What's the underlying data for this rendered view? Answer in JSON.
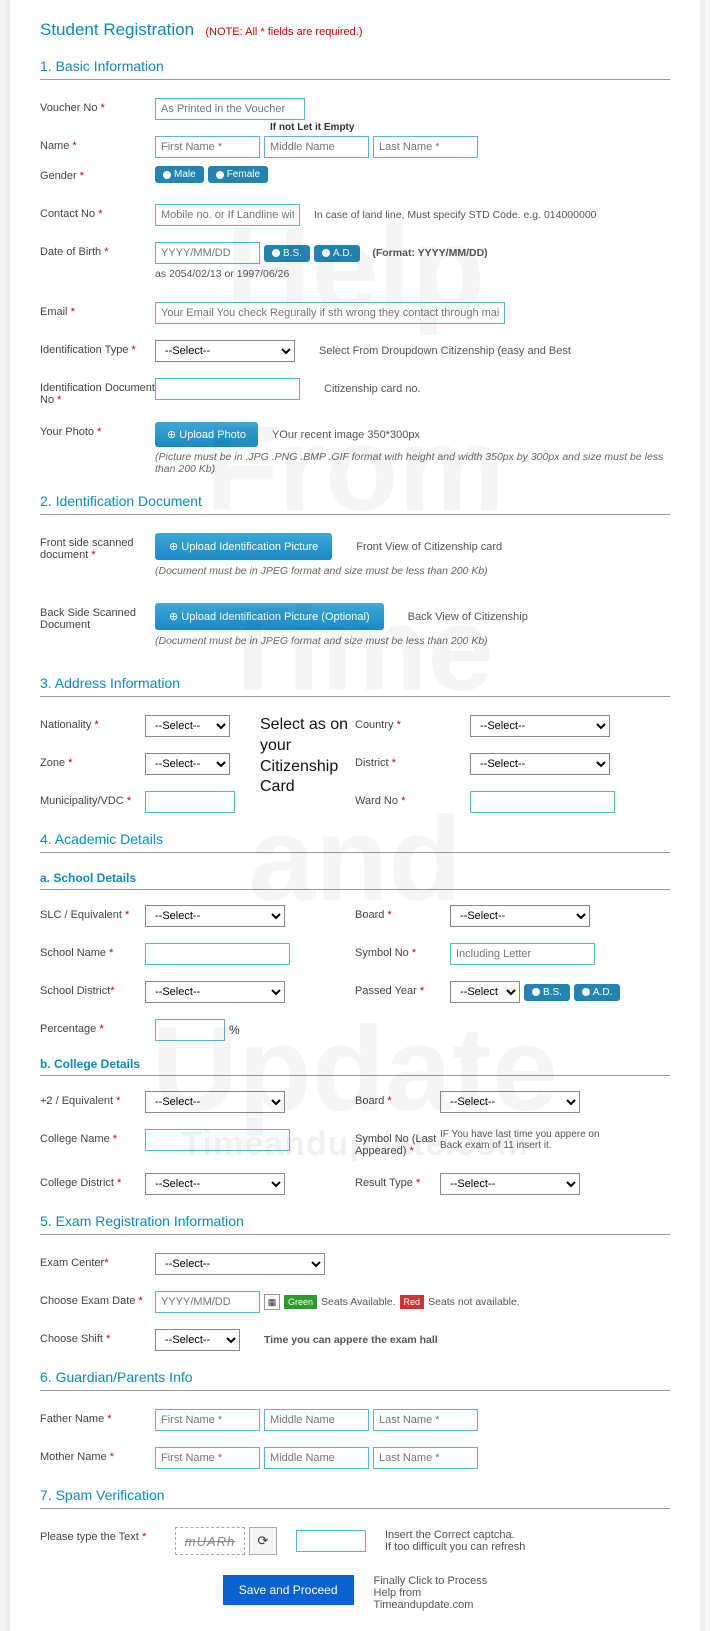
{
  "title": "Student Registration",
  "title_note": "(NOTE: All * fields are required.)",
  "sections": {
    "basic": "1. Basic Information",
    "iddoc": "2. Identification Document",
    "address": "3. Address Information",
    "academic": "4. Academic Details",
    "school_sub": "a. School Details",
    "college_sub": "b. College Details",
    "exam": "5. Exam Registration Information",
    "guardian": "6. Guardian/Parents Info",
    "spam": "7. Spam Verification"
  },
  "labels": {
    "voucher": "Voucher No",
    "name": "Name",
    "gender": "Gender",
    "contact": "Contact No",
    "dob": "Date of Birth",
    "email": "Email",
    "idtype": "Identification Type",
    "iddoc": "Identification Document No",
    "photo": "Your Photo",
    "frontscan": "Front side scanned document",
    "backscan": "Back Side Scanned Document",
    "nationality": "Nationality",
    "country": "Country",
    "zone": "Zone",
    "district": "District",
    "muni": "Municipality/VDC",
    "ward": "Ward No",
    "slc": "SLC / Equivalent",
    "board": "Board",
    "schoolname": "School Name",
    "symbol": "Symbol No",
    "schooldist": "School District",
    "passedyr": "Passed Year",
    "pct": "Percentage",
    "plus2": "+2 / Equivalent",
    "collname": "College Name",
    "symbol_last": "Symbol No (Last Appeared)",
    "colldist": "College District",
    "restype": "Result Type",
    "examcenter": "Exam Center",
    "examdate": "Choose Exam Date",
    "shift": "Choose Shift",
    "father": "Father Name",
    "mother": "Mother Name",
    "captcha": "Please type the Text"
  },
  "placeholders": {
    "voucher": "As Printed in the Voucher",
    "fname": "First Name *",
    "mname": "Middle Name",
    "lname": "Last Name *",
    "contact": "Mobile no. or If Landline with Area code",
    "dob": "YYYY/MM/DD",
    "email": "Your Email You check Regurally if sth wrong they contact through mail",
    "symbol_inc": "Including Letter",
    "examdate": "YYYY/MM/DD"
  },
  "buttons": {
    "male": "Male",
    "female": "Female",
    "bs": "B.S.",
    "ad": "A.D.",
    "upload_photo": "Upload Photo",
    "upload_id": "Upload Identification Picture",
    "upload_id_opt": "Upload Identification Picture (Optional)",
    "submit": "Save and Proceed"
  },
  "hints": {
    "name_middle": "If not Let it Empty",
    "contact": "In case of land line, Must specify STD Code. e.g. 014000000",
    "dob_fmt": "(Format: YYYY/MM/DD)",
    "dob_eg": "as 2054/02/13 or 1997/06/26",
    "idtype": "Select From Droupdown Citizenship (easy and Best",
    "iddoc": "Citizenship card no.",
    "photo": "YOur recent image 350*300px",
    "photo_fmt": "(Picture must be in .JPG .PNG .BMP .GIF format with height and width 350px by 300px and size must be less than 200 Kb)",
    "front": "Front View of Citizenship card",
    "doc_fmt": "(Document must be in JPEG format and size must be less than 200 Kb)",
    "back": "Back View of Citizenship",
    "address_overlay": "Select as on your Citizenship Card",
    "symbol_last": "IF You have last time you appere on Back exam of 11 insert it.",
    "seats_av": "Seats Available.",
    "seats_na": "Seats not available.",
    "shift": "Time you can appere the exam hall",
    "captcha1": "Insert the Correct captcha.",
    "captcha2": "If too difficult you can refresh",
    "submit1": "Finally Click to Process",
    "submit2": "Help from",
    "submit3": "Timeandupdate.com"
  },
  "select_default": "--Select--",
  "captcha_text": "mUARh",
  "pct_unit": "%",
  "badges": {
    "green": "Green",
    "red": "Red"
  },
  "watermarks": {
    "help": "Help",
    "from": "From",
    "time": "Time",
    "and": "and",
    "update": "Update",
    "url": "Timeandupdate.com"
  }
}
